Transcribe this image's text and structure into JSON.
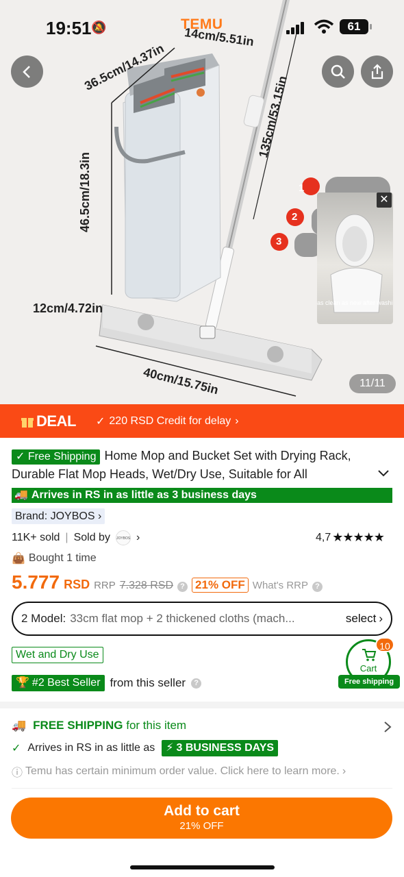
{
  "status": {
    "time": "19:51",
    "brand": "TEMU",
    "battery": "61"
  },
  "gallery": {
    "counter": "11/11",
    "dimensions": {
      "top": "14cm/5.51in",
      "depth": "36.5cm/14.37in",
      "handle": "135cm/53.15in",
      "height": "46.5cm/18.3in",
      "width": "12cm/4.72in",
      "pad": "40cm/15.75in"
    },
    "video_caption": "as clean as new after washi",
    "steps": [
      "1",
      "2",
      "3"
    ]
  },
  "deal": {
    "label": "DEAL",
    "credit": "220 RSD Credit for delay"
  },
  "product": {
    "free_shipping_tag": "Free Shipping",
    "title": "Home Mop and Bucket Set with Drying Rack, Durable Flat Mop Heads, Wet/Dry Use, Suitable for All",
    "arrives": "Arrives in RS in as little as 3 business days",
    "brand": "Brand: JOYBOS",
    "sold": "11K+ sold",
    "sold_by": "Sold by",
    "seller_logo": "JOYBOS",
    "rating": "4,7",
    "stars": "★★★★★",
    "bought": "Bought 1 time",
    "price": "5.777",
    "currency": "RSD",
    "rrp_label": "RRP",
    "rrp_value": "7.328 RSD",
    "discount": "21% OFF",
    "whats_rrp": "What's RRP",
    "model_label": "2 Model:",
    "model_value": "33cm flat mop + 2 thickened cloths (mach...",
    "model_select": "select",
    "feature_tag": "Wet and Dry Use",
    "best_seller": "#2 Best Seller",
    "from_seller": "from this seller"
  },
  "cart_widget": {
    "count": "10",
    "label": "Cart",
    "free_shipping": "Free shipping"
  },
  "shipping": {
    "head_bold": "FREE SHIPPING",
    "head_rest": "for this item",
    "arrives": "Arrives in RS in as little as",
    "days": "3 BUSINESS DAYS",
    "notice": "Temu has certain minimum order value. Click here to learn more."
  },
  "add_to_cart": {
    "label": "Add to cart",
    "sub": "21% OFF"
  },
  "colors": {
    "accent_orange": "#fb7701",
    "deal_red": "#fa4a15",
    "green": "#0a8a1a"
  }
}
